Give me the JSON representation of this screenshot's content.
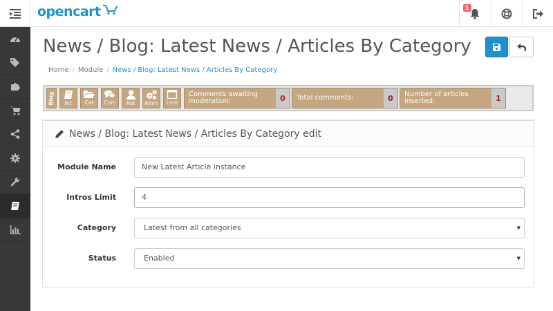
{
  "header": {
    "logo_text": "opencart",
    "alerts_count": "1"
  },
  "sidebar": {
    "items": [
      {
        "icon": "dashboard-icon"
      },
      {
        "icon": "tags-icon"
      },
      {
        "icon": "puzzle-icon"
      },
      {
        "icon": "cart-icon"
      },
      {
        "icon": "share-icon"
      },
      {
        "icon": "cog-icon"
      },
      {
        "icon": "wrench-icon"
      },
      {
        "icon": "book-icon",
        "active": true
      },
      {
        "icon": "bar-chart-icon"
      }
    ]
  },
  "page": {
    "title": "News / Blog: Latest News / Articles By Category",
    "breadcrumb": [
      "Home",
      "Module",
      "News / Blog: Latest News / Articles By Category"
    ]
  },
  "blog_toolbar": {
    "tag": "Blog",
    "buttons": [
      {
        "label": "Art",
        "icon": "book-icon"
      },
      {
        "label": "Cat",
        "icon": "folder-open-icon"
      },
      {
        "label": "Com",
        "icon": "comments-icon"
      },
      {
        "label": "Aut",
        "icon": "user-icon"
      },
      {
        "label": "Amm",
        "icon": "cogs-icon"
      },
      {
        "label": "Lnm",
        "icon": "window-icon"
      }
    ],
    "stats": [
      {
        "label": "Comments awaiting moderation:",
        "value": "0"
      },
      {
        "label": "Total comments:",
        "value": "0"
      },
      {
        "label": "Number of articles inserted:",
        "value": "1"
      }
    ]
  },
  "panel": {
    "title": "News / Blog: Latest News / Articles By Category edit",
    "fields": {
      "module_name": {
        "label": "Module Name",
        "value": "New Latest Article instance"
      },
      "intros_limit": {
        "label": "Intros Limit",
        "value": "4"
      },
      "category": {
        "label": "Category",
        "value": "Latest from all categories"
      },
      "status": {
        "label": "Status",
        "value": "Enabled"
      }
    }
  },
  "colors": {
    "accent": "#1e91cf",
    "sidebar_bg": "#383838",
    "blog_tan": "#c4a681",
    "alert_badge": "#f56b6b"
  }
}
